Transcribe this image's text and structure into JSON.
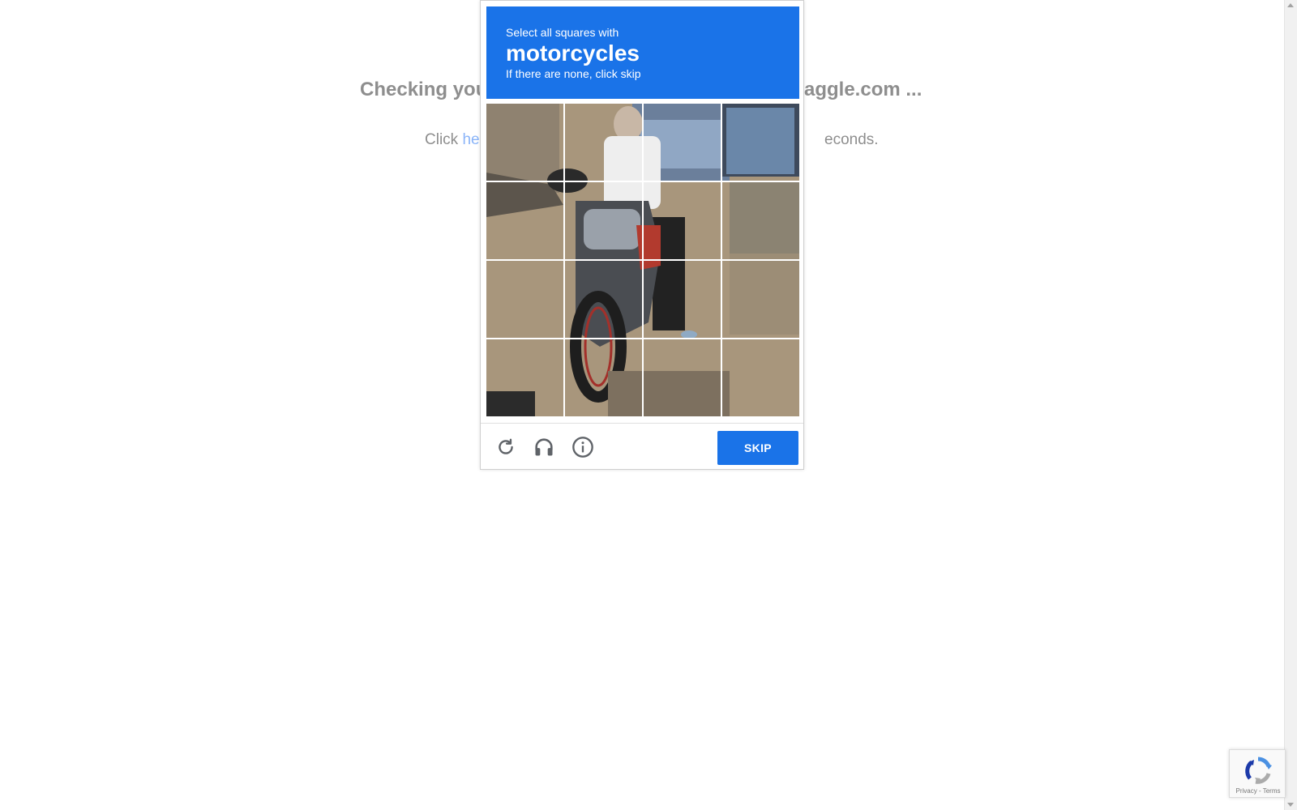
{
  "background": {
    "heading_left": "Checking you",
    "heading_right": "aggle.com ...",
    "line_left": "Click ",
    "line_link": "he",
    "line_right": "econds."
  },
  "captcha": {
    "instruction": "Select all squares with",
    "target": "motorcycles",
    "hint": "If there are none, click skip",
    "skip_label": "SKIP",
    "reload_icon": "reload-icon",
    "audio_icon": "headphones-icon",
    "info_icon": "info-icon",
    "accent_color": "#1a73e8",
    "grid_rows": 4,
    "grid_cols": 4
  },
  "badge": {
    "privacy": "Privacy",
    "separator": " - ",
    "terms": "Terms"
  }
}
